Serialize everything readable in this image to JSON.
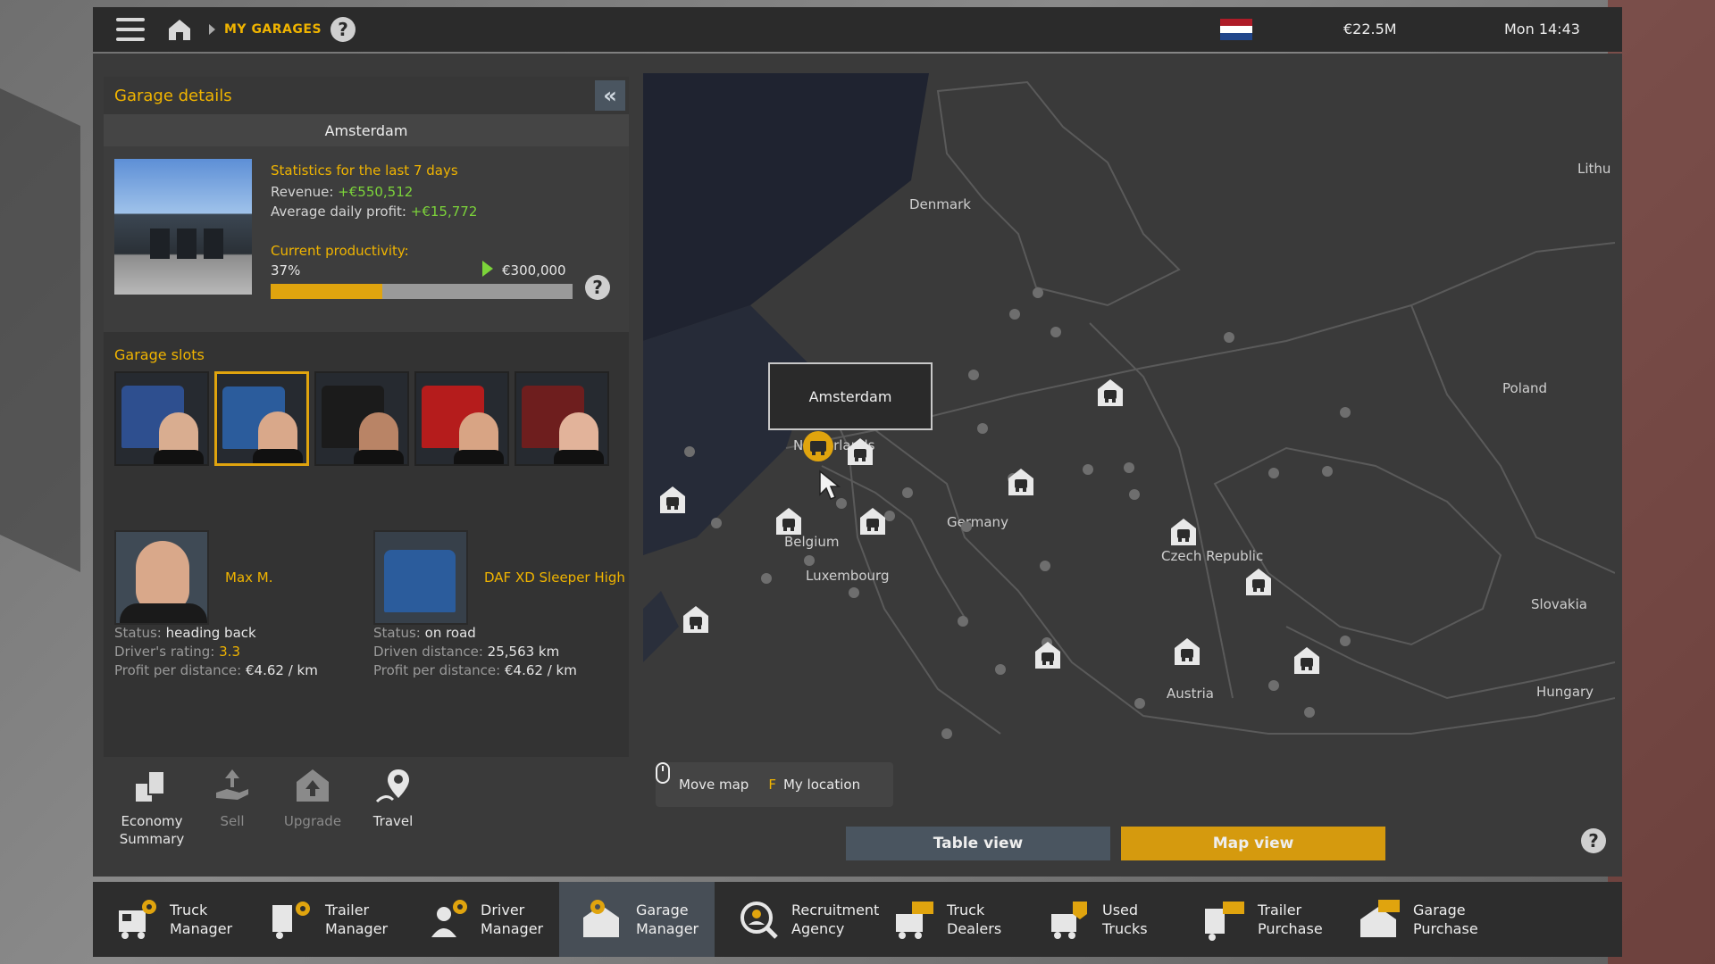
{
  "topbar": {
    "breadcrumb": "MY GARAGES",
    "help": "?",
    "money": "€22.5M",
    "clock": "Mon 14:43",
    "flag_colors": [
      "#ae1c28",
      "#ffffff",
      "#21468b"
    ]
  },
  "garage_details": {
    "title": "Garage details",
    "collapse": "«",
    "city": "Amsterdam",
    "stats_title": "Statistics for the last 7 days",
    "revenue_label": "Revenue:",
    "revenue_value": "+€550,512",
    "avg_label": "Average daily profit:",
    "avg_value": "+€15,772",
    "productivity_label": "Current productivity:",
    "productivity_pct": "37%",
    "productivity_fraction": 0.37,
    "productivity_target": "€300,000",
    "help": "?"
  },
  "slots": {
    "title": "Garage slots",
    "items": [
      {
        "truck_color": "#2e4f8f",
        "face_color": "#d9ad90",
        "selected": false
      },
      {
        "truck_color": "#2b5c9c",
        "face_color": "#d9a88a",
        "selected": true
      },
      {
        "truck_color": "#1b1b1b",
        "face_color": "#b98466",
        "selected": false
      },
      {
        "truck_color": "#b51c1c",
        "face_color": "#d8a484",
        "selected": false
      },
      {
        "truck_color": "#6e1e1e",
        "face_color": "#e2b39a",
        "selected": false
      }
    ]
  },
  "driver": {
    "name": "Max M.",
    "status_label": "Status:",
    "status": "heading back",
    "rating_label": "Driver's rating:",
    "rating": "3.3",
    "profit_label": "Profit per distance:",
    "profit": "€4.62 / km"
  },
  "truck": {
    "name": "DAF XD Sleeper High",
    "status_label": "Status:",
    "status": "on road",
    "distance_label": "Driven distance:",
    "distance": "25,563 km",
    "profit_label": "Profit per distance:",
    "profit": "€4.62 / km"
  },
  "actions": [
    {
      "label": "Economy Summary",
      "icon": "economy-icon",
      "enabled": true
    },
    {
      "label": "Sell",
      "icon": "sell-icon",
      "enabled": false
    },
    {
      "label": "Upgrade",
      "icon": "upgrade-icon",
      "enabled": false
    },
    {
      "label": "Travel",
      "icon": "travel-pin-icon",
      "enabled": true
    }
  ],
  "map": {
    "tooltip": "Amsterdam",
    "labels": {
      "denmark": "Denmark",
      "lithuania": "Lithu",
      "netherlands": "Netherlands",
      "poland": "Poland",
      "germany": "Germany",
      "belgium": "Belgium",
      "luxembourg": "Luxembourg",
      "czech": "Czech Republic",
      "slovakia": "Slovakia",
      "austria": "Austria",
      "hungary": "Hungary"
    },
    "hint_move": "Move map",
    "hint_key": "F",
    "hint_location": "My location"
  },
  "view_tabs": {
    "table": "Table view",
    "map": "Map view",
    "help": "?"
  },
  "bottom_nav": [
    {
      "label": "Truck Manager",
      "icon": "truck-manager-icon",
      "active": false
    },
    {
      "label": "Trailer Manager",
      "icon": "trailer-manager-icon",
      "active": false
    },
    {
      "label": "Driver Manager",
      "icon": "driver-manager-icon",
      "active": false
    },
    {
      "label": "Garage Manager",
      "icon": "garage-manager-icon",
      "active": true
    },
    {
      "label": "Recruitment Agency",
      "icon": "recruitment-icon",
      "active": false
    },
    {
      "label": "Truck Dealers",
      "icon": "truck-dealers-icon",
      "active": false
    },
    {
      "label": "Used Trucks",
      "icon": "used-trucks-icon",
      "active": false
    },
    {
      "label": "Trailer Purchase",
      "icon": "trailer-purchase-icon",
      "active": false
    },
    {
      "label": "Garage Purchase",
      "icon": "garage-purchase-icon",
      "active": false
    }
  ]
}
